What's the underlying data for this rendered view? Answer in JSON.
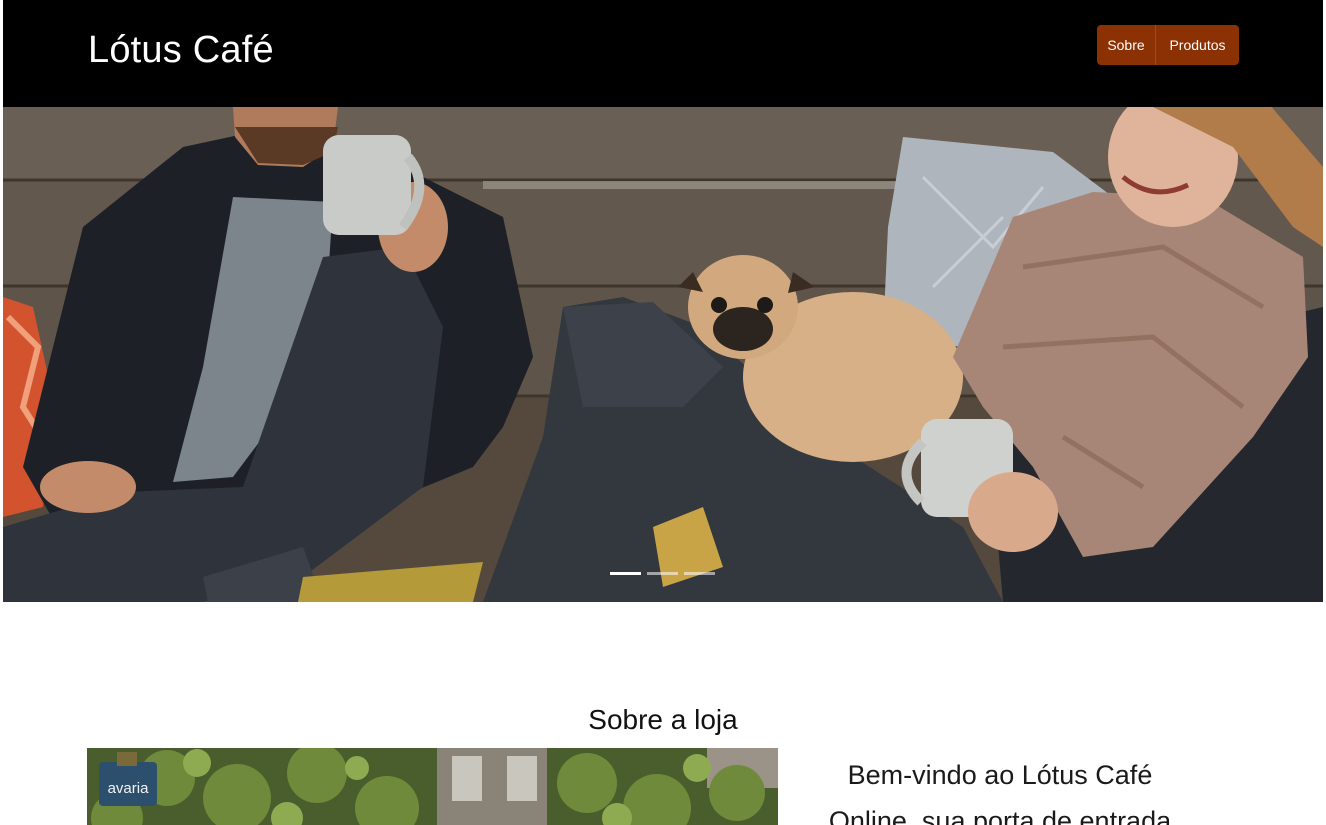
{
  "header": {
    "brand": "Lótus Café",
    "nav": [
      {
        "label": "Sobre"
      },
      {
        "label": "Produtos"
      }
    ]
  },
  "hero": {
    "carousel_indicators": 3,
    "active_indicator": 1
  },
  "about": {
    "title": "Sobre a loja",
    "photo_sign_text": "avaria",
    "text_line_1": "Bem-vindo ao Lótus Café",
    "text_line_2": "Online, sua porta de entrada"
  },
  "colors": {
    "header_bg": "#000000",
    "nav_button_bg": "#8b3104",
    "text_dark": "#111111"
  }
}
